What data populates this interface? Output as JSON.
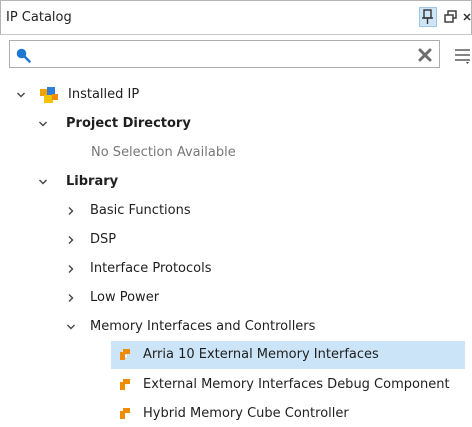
{
  "panel": {
    "title": "IP Catalog"
  },
  "search": {
    "value": "",
    "placeholder": ""
  },
  "tree": {
    "installed_ip": "Installed IP",
    "project_directory": "Project Directory",
    "no_selection": "No Selection Available",
    "library": "Library",
    "basic_functions": "Basic Functions",
    "dsp": "DSP",
    "interface_protocols": "Interface Protocols",
    "low_power": "Low Power",
    "memory_interfaces": "Memory Interfaces and Controllers",
    "items": [
      "Arria 10 External Memory Interfaces",
      "External Memory Interfaces Debug Component",
      "Hybrid Memory Cube Controller"
    ]
  },
  "colors": {
    "selection": "#cce4f7",
    "ip_icon": "#f08c00",
    "search_icon": "#1e78d2"
  }
}
